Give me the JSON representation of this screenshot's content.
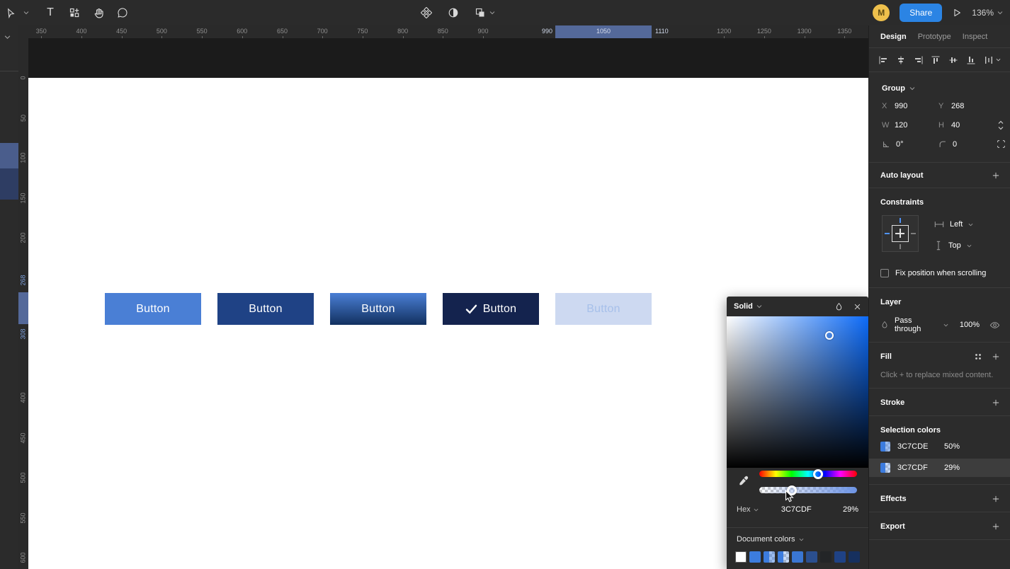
{
  "toolbar": {
    "share_label": "Share",
    "avatar_initial": "M",
    "zoom_level": "136%",
    "tools": [
      "move-tool",
      "text-tool",
      "resources-tool",
      "hand-tool",
      "comment-tool"
    ],
    "center_tools": [
      "component",
      "mask",
      "boolean-group"
    ]
  },
  "rulers": {
    "horizontal": {
      "unit_labels": [
        350,
        400,
        450,
        500,
        550,
        600,
        650,
        700,
        750,
        800,
        850,
        900,
        1200,
        1250,
        1300,
        1350
      ],
      "selection_start": "990",
      "selection_mid": "1050",
      "selection_end": "1110"
    },
    "vertical": {
      "unit_labels": [
        0,
        50,
        100,
        150,
        200,
        400,
        450,
        500,
        550,
        600
      ],
      "selection_start": "268",
      "selection_end": "308"
    }
  },
  "canvas": {
    "header_bar_color": "#1b1b1b",
    "buttons": [
      {
        "label": "Button",
        "fill": "#4a7fd5",
        "text_color": "#ffffff"
      },
      {
        "label": "Button",
        "fill": "#1f4285",
        "text_color": "#ffffff"
      },
      {
        "label": "Button",
        "fill": [
          "#4a7fd5",
          "#12305f"
        ],
        "text_color": "#ffffff"
      },
      {
        "label": "Button",
        "fill": "#14234e",
        "text_color": "#ffffff",
        "has_check": true
      },
      {
        "label": "Button",
        "fill": "#cdd9f1",
        "text_color": "#a7c0ea"
      }
    ]
  },
  "color_picker": {
    "mode_label": "Solid",
    "hex_format_label": "Hex",
    "hex_value": "3C7CDF",
    "alpha_value": "29%",
    "hue_position_pct": 60,
    "alpha_position_pct": 33,
    "document_colors_label": "Document colors",
    "document_colors": [
      {
        "hex": "#ffffff"
      },
      {
        "hex": "#3c7cde"
      },
      {
        "hex": "#3c7cde",
        "alpha": true,
        "overlay": "rgba(60,124,222,0.5)"
      },
      {
        "hex": "#3c7cde",
        "alpha": true,
        "overlay": "rgba(60,124,222,0.29)"
      },
      {
        "hex": "#3a76d2"
      },
      {
        "hex": "#2b4f8f"
      },
      {
        "hex": "#232527"
      },
      {
        "hex": "#1f4285"
      },
      {
        "hex": "#16305e"
      }
    ]
  },
  "inspector": {
    "tabs": [
      {
        "label": "Design",
        "active": true
      },
      {
        "label": "Prototype",
        "active": false
      },
      {
        "label": "Inspect",
        "active": false
      }
    ],
    "selection": {
      "type_label": "Group",
      "x": {
        "label": "X",
        "value": "990"
      },
      "y": {
        "label": "Y",
        "value": "268"
      },
      "w": {
        "label": "W",
        "value": "120"
      },
      "h": {
        "label": "H",
        "value": "40"
      },
      "rotation": {
        "value": "0°"
      },
      "radius": {
        "value": "0"
      }
    },
    "auto_layout": {
      "title": "Auto layout"
    },
    "constraints": {
      "title": "Constraints",
      "horizontal": "Left",
      "vertical": "Top",
      "fix_label": "Fix position when scrolling"
    },
    "layer": {
      "title": "Layer",
      "blend_mode": "Pass through",
      "opacity": "100%"
    },
    "fill": {
      "title": "Fill",
      "hint": "Click + to replace mixed content."
    },
    "stroke": {
      "title": "Stroke"
    },
    "selection_colors": {
      "title": "Selection colors",
      "items": [
        {
          "hex": "3C7CDE",
          "opacity": "50%",
          "overlay": "rgba(60,124,222,0.5)"
        },
        {
          "hex": "3C7CDF",
          "opacity": "29%",
          "overlay": "rgba(60,124,222,0.29)"
        }
      ]
    },
    "effects": {
      "title": "Effects"
    },
    "export": {
      "title": "Export"
    }
  }
}
